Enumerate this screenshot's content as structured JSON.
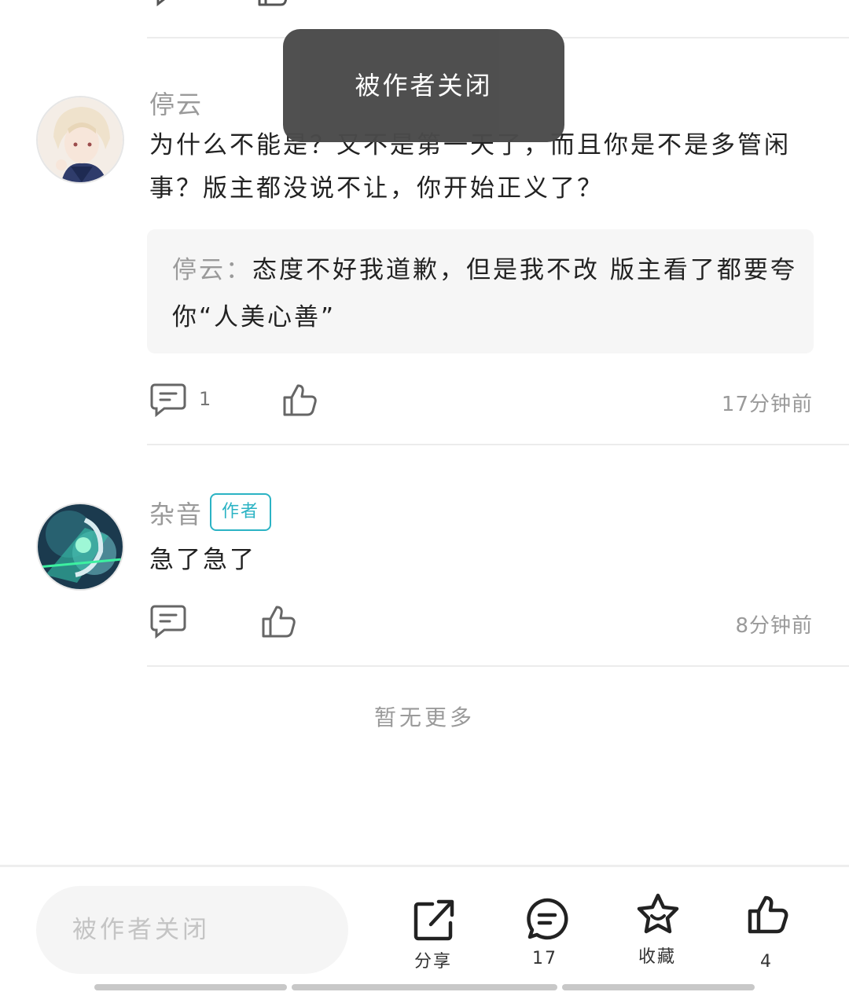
{
  "toast": {
    "text": "被作者关闭"
  },
  "comments": [
    {
      "username": "停云",
      "text": "为什么不能是？又不是第一天了，而且你是不是多管闲事？版主都没说不让，你开始正义了？",
      "quote": {
        "name": "停云",
        "separator": "：",
        "text": "态度不好我道歉，但是我不改 版主看了都要夸你“人美心善”"
      },
      "reply_count": "1",
      "time": "17分钟前"
    },
    {
      "username": "杂音",
      "badge": "作者",
      "text": "急了急了",
      "time": "8分钟前"
    }
  ],
  "footer": {
    "no_more": "暂无更多"
  },
  "bottom_bar": {
    "input_placeholder": "被作者关闭",
    "share_label": "分享",
    "comment_count": "17",
    "favorite_label": "收藏",
    "like_count": "4"
  },
  "icons": {
    "comment": "comment-icon",
    "like": "thumbs-up-icon",
    "share": "share-icon",
    "star": "star-icon"
  },
  "colors": {
    "badge": "#2bb3c4",
    "toast_bg": "#4a4a4a",
    "muted_text": "#9a9a9a"
  }
}
